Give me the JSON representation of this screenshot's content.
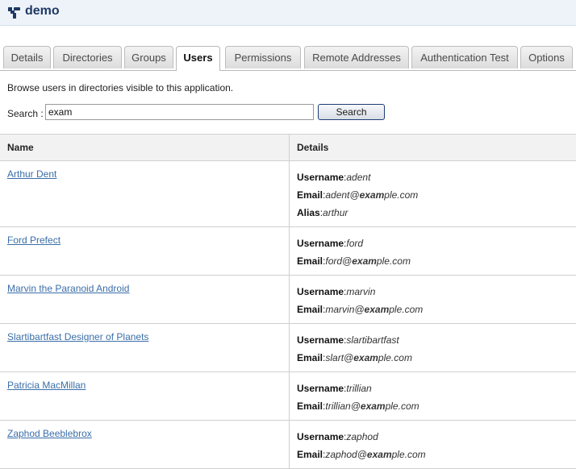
{
  "app": {
    "title": "demo",
    "icon": "app-logo-icon"
  },
  "tabs": [
    {
      "label": "Details",
      "active": false
    },
    {
      "label": "Directories",
      "active": false
    },
    {
      "label": "Groups",
      "active": false
    },
    {
      "label": "Users",
      "active": true
    },
    {
      "label": "Permissions",
      "active": false
    },
    {
      "label": "Remote Addresses",
      "active": false
    },
    {
      "label": "Authentication Test",
      "active": false
    },
    {
      "label": "Options",
      "active": false
    }
  ],
  "intro": "Browse users in directories visible to this application.",
  "search": {
    "label": "Search :",
    "value": "exam",
    "button_label": "Search"
  },
  "table": {
    "columns": {
      "name": "Name",
      "details": "Details"
    },
    "labels": {
      "username": "Username",
      "email": "Email",
      "alias": "Alias"
    },
    "highlight": "exam",
    "rows": [
      {
        "name": "Arthur Dent",
        "username": "adent",
        "email": "adent@example.com",
        "alias": "arthur"
      },
      {
        "name": "Ford Prefect",
        "username": "ford",
        "email": "ford@example.com"
      },
      {
        "name": "Marvin the Paranoid Android",
        "username": "marvin",
        "email": "marvin@example.com"
      },
      {
        "name": "Slartibartfast Designer of Planets",
        "username": "slartibartfast",
        "email": "slart@example.com"
      },
      {
        "name": "Patricia MacMillan",
        "username": "trillian",
        "email": "trillian@example.com"
      },
      {
        "name": "Zaphod Beeblebrox",
        "username": "zaphod",
        "email": "zaphod@example.com"
      }
    ]
  }
}
